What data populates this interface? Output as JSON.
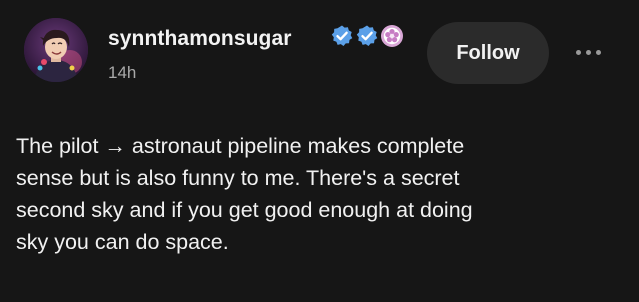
{
  "post": {
    "author": {
      "username": "synnthamonsugar",
      "avatar_icon": "avatar-image",
      "badges": [
        "verified-checkmark-icon",
        "verified-checkmark-icon",
        "pink-flower-badge-icon"
      ]
    },
    "timestamp": "14h",
    "follow_label": "Follow",
    "more_icon": "more-options-icon",
    "text_lines": [
      "The pilot → astronaut pipeline makes complete",
      "sense but is also funny to me. There's a secret",
      "second sky and if you get good enough at doing",
      "sky you can do space."
    ]
  },
  "colors": {
    "background": "#161616",
    "text": "#f1f1f1",
    "muted_text": "#a9a9a9",
    "follow_button": "#2b2b2b",
    "badge_blue": "#5ba0e8",
    "badge_pink": "#d9a7d6"
  }
}
